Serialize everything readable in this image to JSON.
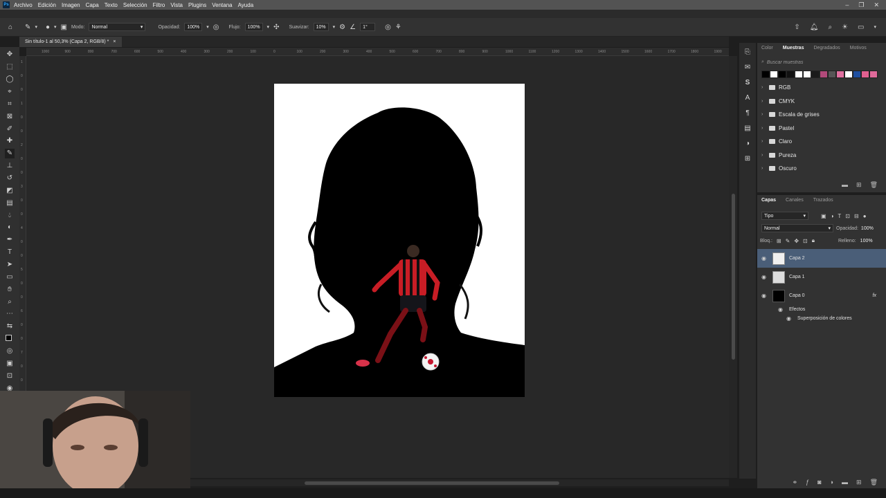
{
  "menu": {
    "logo": "Ps",
    "items": [
      "Archivo",
      "Edición",
      "Imagen",
      "Capa",
      "Texto",
      "Selección",
      "Filtro",
      "Vista",
      "Plugins",
      "Ventana",
      "Ayuda"
    ],
    "window_controls": [
      "–",
      "❐",
      "✕"
    ]
  },
  "options": {
    "mode_label": "Modo:",
    "mode_value": "Normal",
    "opacity_label": "Opacidad:",
    "opacity_value": "100%",
    "flow_label": "Flujo:",
    "flow_value": "100%",
    "smoothing_label": "Suavizar:",
    "smoothing_value": "10%",
    "angle_value": "1°"
  },
  "document": {
    "tab_title": "Sin título-1 al 50,3% (Capa 2, RGB/8) *",
    "tab_close": "×"
  },
  "ruler": {
    "h_ticks": [
      "1000",
      "900",
      "800",
      "700",
      "600",
      "500",
      "400",
      "300",
      "200",
      "100",
      "0",
      "100",
      "200",
      "300",
      "400",
      "500",
      "600",
      "700",
      "800",
      "900",
      "1000",
      "1100",
      "1200",
      "1300",
      "1400",
      "1500",
      "1600",
      "1700",
      "1800",
      "1900"
    ],
    "v_ticks": [
      "1",
      "0",
      "0",
      "1",
      "0",
      "0",
      "2",
      "0",
      "0",
      "3",
      "0",
      "0",
      "4",
      "0",
      "0",
      "5",
      "0",
      "0",
      "6",
      "0",
      "0",
      "7",
      "0",
      "0",
      "8",
      "0",
      "0",
      "9",
      "0",
      "0"
    ]
  },
  "swatches": {
    "tabs": [
      "Color",
      "Muestras",
      "Degradados",
      "Motivos"
    ],
    "active_tab": "Muestras",
    "search_placeholder": "Buscar muestras",
    "recent_colors": [
      "#000000",
      "#ffffff",
      "#000000",
      "#111111",
      "#ffffff",
      "#ffffff",
      "#1a1a1a",
      "#b14a7a",
      "#555555",
      "#e070a0",
      "#ffffff",
      "#1f4fa0",
      "#e06090",
      "#e06a9a"
    ],
    "folders": [
      "RGB",
      "CMYK",
      "Escala de grises",
      "Pastel",
      "Claro",
      "Pureza",
      "Oscuro"
    ]
  },
  "layers": {
    "tabs": [
      "Capas",
      "Canales",
      "Trazados"
    ],
    "active_tab": "Capas",
    "filter_label": "Tipo",
    "blend_mode": "Normal",
    "opacity_label": "Opacidad:",
    "opacity_value": "100%",
    "lock_label": "Bloq.:",
    "fill_label": "Relleno:",
    "fill_value": "100%",
    "items": [
      {
        "name": "Capa 2",
        "selected": true
      },
      {
        "name": "Capa 1",
        "selected": false
      },
      {
        "name": "Capa 0",
        "selected": false
      }
    ],
    "effects_label": "Efectos",
    "effect_name": "Superposición de colores",
    "fx_label": "fx"
  },
  "colors": {
    "accent": "#31a8ff",
    "selection": "#4a5e78",
    "panel": "#323232"
  }
}
